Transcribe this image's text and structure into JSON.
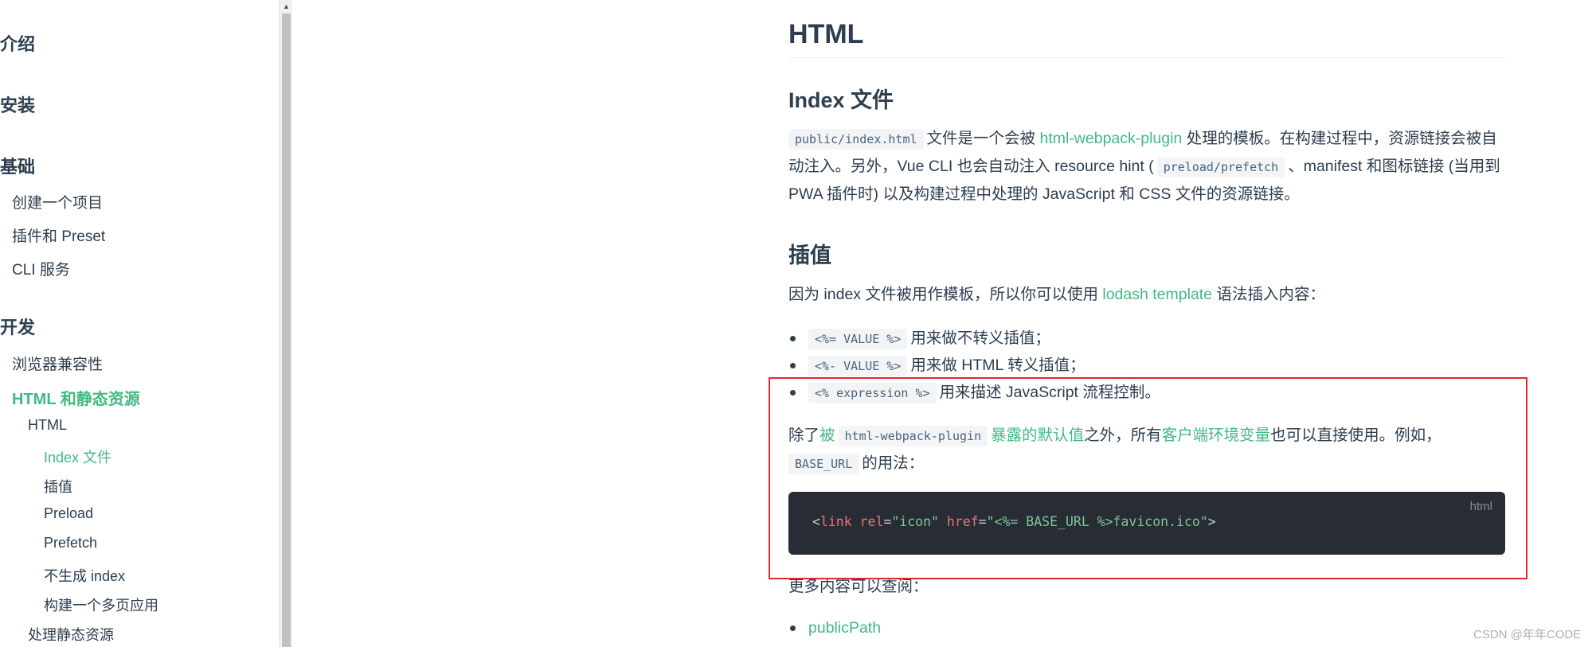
{
  "sidebar": {
    "groups": {
      "intro": "介绍",
      "install": "安装",
      "basics": "基础",
      "development": "开发"
    },
    "items": {
      "create_project": "创建一个项目",
      "plugins_preset": "插件和 Preset",
      "cli_service": "CLI 服务",
      "browser_compat": "浏览器兼容性",
      "html_static": "HTML 和静态资源",
      "html": "HTML",
      "index_file": "Index 文件",
      "interpolation": "插值",
      "preload": "Preload",
      "prefetch": "Prefetch",
      "no_index": "不生成 index",
      "multi_page": "构建一个多页应用",
      "static_assets": "处理静态资源"
    }
  },
  "content": {
    "h1": "HTML",
    "index_section": {
      "title": "Index 文件",
      "code_index": "public/index.html",
      "t1": "文件是一个会被",
      "link_hwp": "html-webpack-plugin",
      "t2": "处理的模板。在构建过程中，资源链接会被自动注入。另外，Vue CLI 也会自动注入 resource hint (",
      "code_preload": "preload/prefetch",
      "t3": "、manifest 和图标链接 (当用到 PWA 插件时) 以及构建过程中处理的 JavaScript 和 CSS 文件的资源链接。"
    },
    "interp_section": {
      "title": "插值",
      "p1_a": "因为 index 文件被用作模板，所以你可以使用",
      "p1_link": "lodash template",
      "p1_b": "语法插入内容：",
      "list": [
        {
          "code": "<%= VALUE %>",
          "text": "用来做不转义插值；"
        },
        {
          "code": "<%- VALUE %>",
          "text": "用来做 HTML 转义插值；"
        },
        {
          "code": "<% expression %>",
          "text": "用来描述 JavaScript 流程控制。"
        }
      ],
      "p2_a": "除了",
      "p2_link1": "被",
      "p2_code": "html-webpack-plugin",
      "p2_link2": "暴露的默认值",
      "p2_b": "之外，所有",
      "p2_link3": "客户端环境变量",
      "p2_c": "也可以直接使用。例如，",
      "p2_code2": "BASE_URL",
      "p2_d": "的用法：",
      "code_lang": "html",
      "code": {
        "lt": "<",
        "tag": "link",
        "attr1": "rel",
        "eq": "=",
        "val1": "\"icon\"",
        "attr2": "href",
        "val2": "\"<%= BASE_URL %>favicon.ico\"",
        "gt": ">"
      },
      "more": "更多内容可以查阅：",
      "more_link": "publicPath"
    }
  },
  "watermark": "CSDN @年年CODE"
}
